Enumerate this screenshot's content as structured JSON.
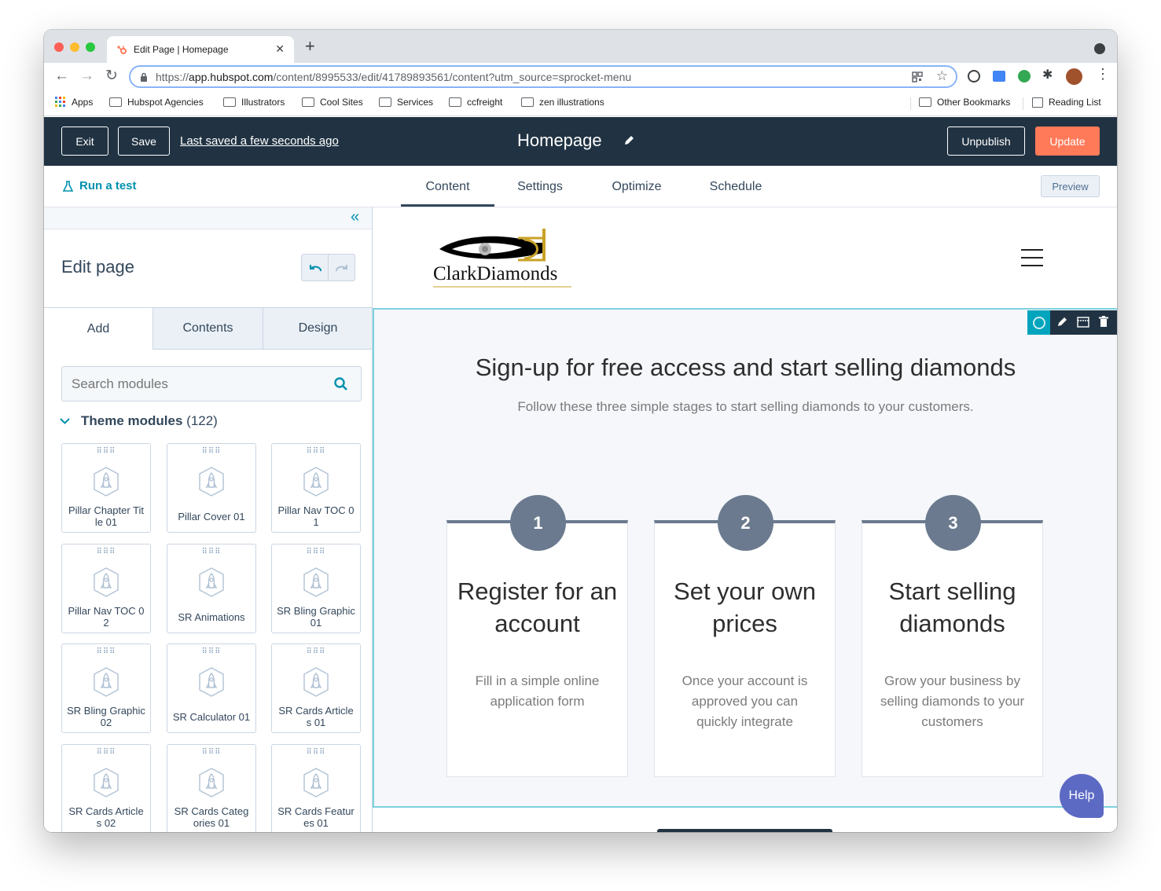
{
  "browser": {
    "tab_title": "Edit Page | Homepage",
    "url_prefix": "https://",
    "url_host": "app.hubspot.com",
    "url_path": "/content/8995533/edit/41789893561/content?utm_source=sprocket-menu",
    "bookmarks": [
      "Apps",
      "Hubspot Agencies",
      "Illustrators",
      "Cool Sites",
      "Services",
      "ccfreight",
      "zen illustrations"
    ],
    "other_bookmarks": "Other Bookmarks",
    "reading_list": "Reading List"
  },
  "header": {
    "exit": "Exit",
    "save": "Save",
    "last_saved": "Last saved a few seconds ago",
    "page_title": "Homepage",
    "unpublish": "Unpublish",
    "update": "Update",
    "accent": "#ff7a59"
  },
  "subnav": {
    "run_test": "Run a test",
    "tabs": [
      "Content",
      "Settings",
      "Optimize",
      "Schedule"
    ],
    "active_tab": "Content",
    "preview": "Preview"
  },
  "sidebar": {
    "title": "Edit page",
    "tabs": [
      "Add",
      "Contents",
      "Design"
    ],
    "search_placeholder": "Search modules",
    "section_title": "Theme modules",
    "section_count": "(122)",
    "modules": [
      "Pillar Chapter Tit le 01",
      "Pillar Cover 01",
      "Pillar Nav TOC 0 1",
      "Pillar Nav TOC 0 2",
      "SR Animations",
      "SR Bling Graphic 01",
      "SR Bling Graphic 02",
      "SR Calculator 01",
      "SR Cards Article s 01",
      "SR Cards Article s 02",
      "SR Cards Categ ories 01",
      "SR Cards Featur es 01"
    ]
  },
  "preview": {
    "logo_text": "ClarkDiamonds",
    "headline": "Sign-up for free access and start selling diamonds",
    "subheadline": "Follow these three simple stages to start selling diamonds to your customers.",
    "steps": [
      {
        "num": "1",
        "title": "Register for an account",
        "desc": "Fill in a simple online application form"
      },
      {
        "num": "2",
        "title": "Set your own prices",
        "desc": "Once your account is approved you can quickly integrate"
      },
      {
        "num": "3",
        "title": "Start selling diamonds",
        "desc": "Grow your business by selling diamonds to your customers"
      }
    ],
    "help": "Help"
  }
}
